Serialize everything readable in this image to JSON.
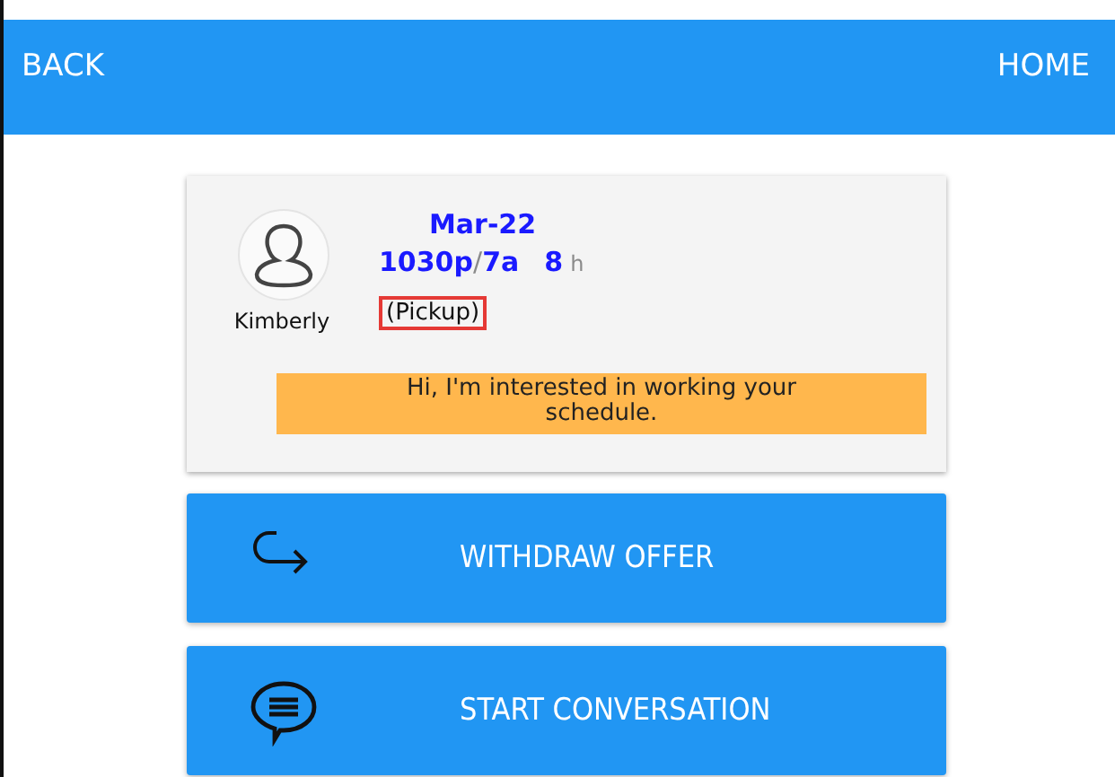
{
  "nav": {
    "back": "BACK",
    "home": "HOME"
  },
  "offer": {
    "name": "Kimberly",
    "date": "Mar-22",
    "start": "1030p",
    "separator": "/",
    "end": "7a",
    "hours": "8",
    "hours_unit": "h",
    "type": "(Pickup)",
    "message": "Hi, I'm interested in working your schedule."
  },
  "actions": [
    {
      "kind": "withdraw",
      "label": "WITHDRAW OFFER"
    },
    {
      "kind": "conversation",
      "label": "START CONVERSATION"
    }
  ]
}
